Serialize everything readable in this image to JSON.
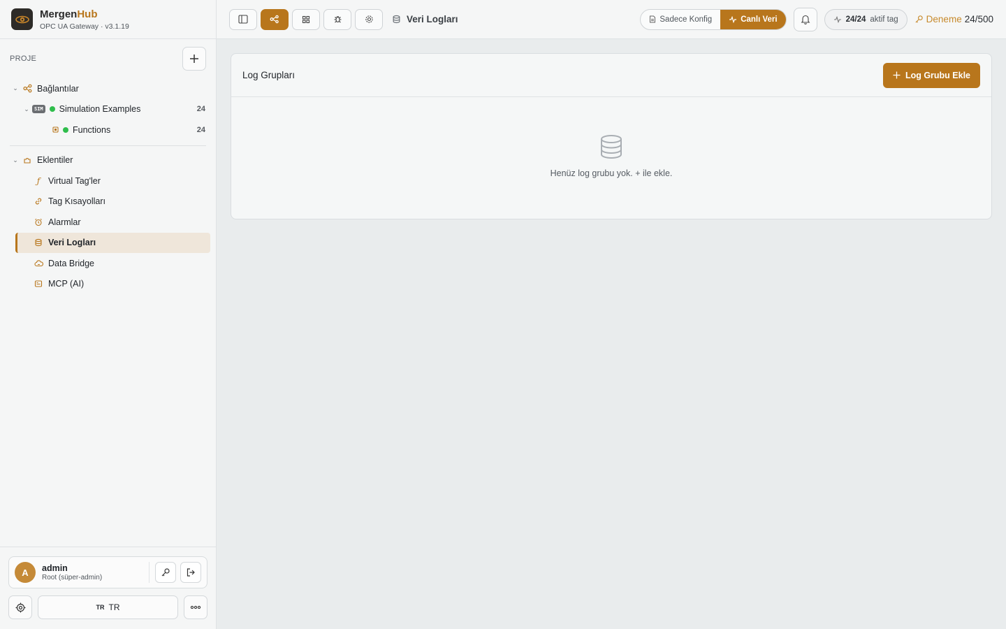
{
  "brand": {
    "name_part1": "Mergen",
    "name_part2": "Hub",
    "subtitle": "OPC UA Gateway · v3.1.19"
  },
  "sidebar": {
    "section_label": "PROJE",
    "connections": {
      "label": "Bağlantılar",
      "children": [
        {
          "badge": "SIM",
          "label": "Simulation Examples",
          "count": "24"
        },
        {
          "label": "Functions",
          "count": "24"
        }
      ]
    },
    "plugins": {
      "label": "Eklentiler",
      "items": [
        {
          "label": "Virtual Tag'ler",
          "icon": "function-icon"
        },
        {
          "label": "Tag Kısayolları",
          "icon": "link-icon"
        },
        {
          "label": "Alarmlar",
          "icon": "alarm-icon"
        },
        {
          "label": "Veri Logları",
          "icon": "database-icon",
          "active": true
        },
        {
          "label": "Data Bridge",
          "icon": "cloud-sync-icon"
        },
        {
          "label": "MCP (AI)",
          "icon": "mcp-icon"
        }
      ]
    },
    "user": {
      "initial": "A",
      "name": "admin",
      "role": "Root (süper-admin)"
    },
    "language": {
      "flag": "TR",
      "label": "TR"
    }
  },
  "topbar": {
    "breadcrumb": "Veri Logları",
    "mode": {
      "config_label": "Sadece Konfig",
      "live_label": "Canlı Veri",
      "selected": "Canlı Veri"
    },
    "tags": {
      "count": "24/24",
      "label": "aktif tag"
    },
    "trial": {
      "label": "Deneme",
      "value": "24/500"
    }
  },
  "main": {
    "card_title": "Log Grupları",
    "add_button": "Log Grubu Ekle",
    "empty_text": "Henüz log grubu yok. + ile ekle."
  },
  "colors": {
    "accent": "#b8761c",
    "status_ok": "#2fbd4c"
  }
}
